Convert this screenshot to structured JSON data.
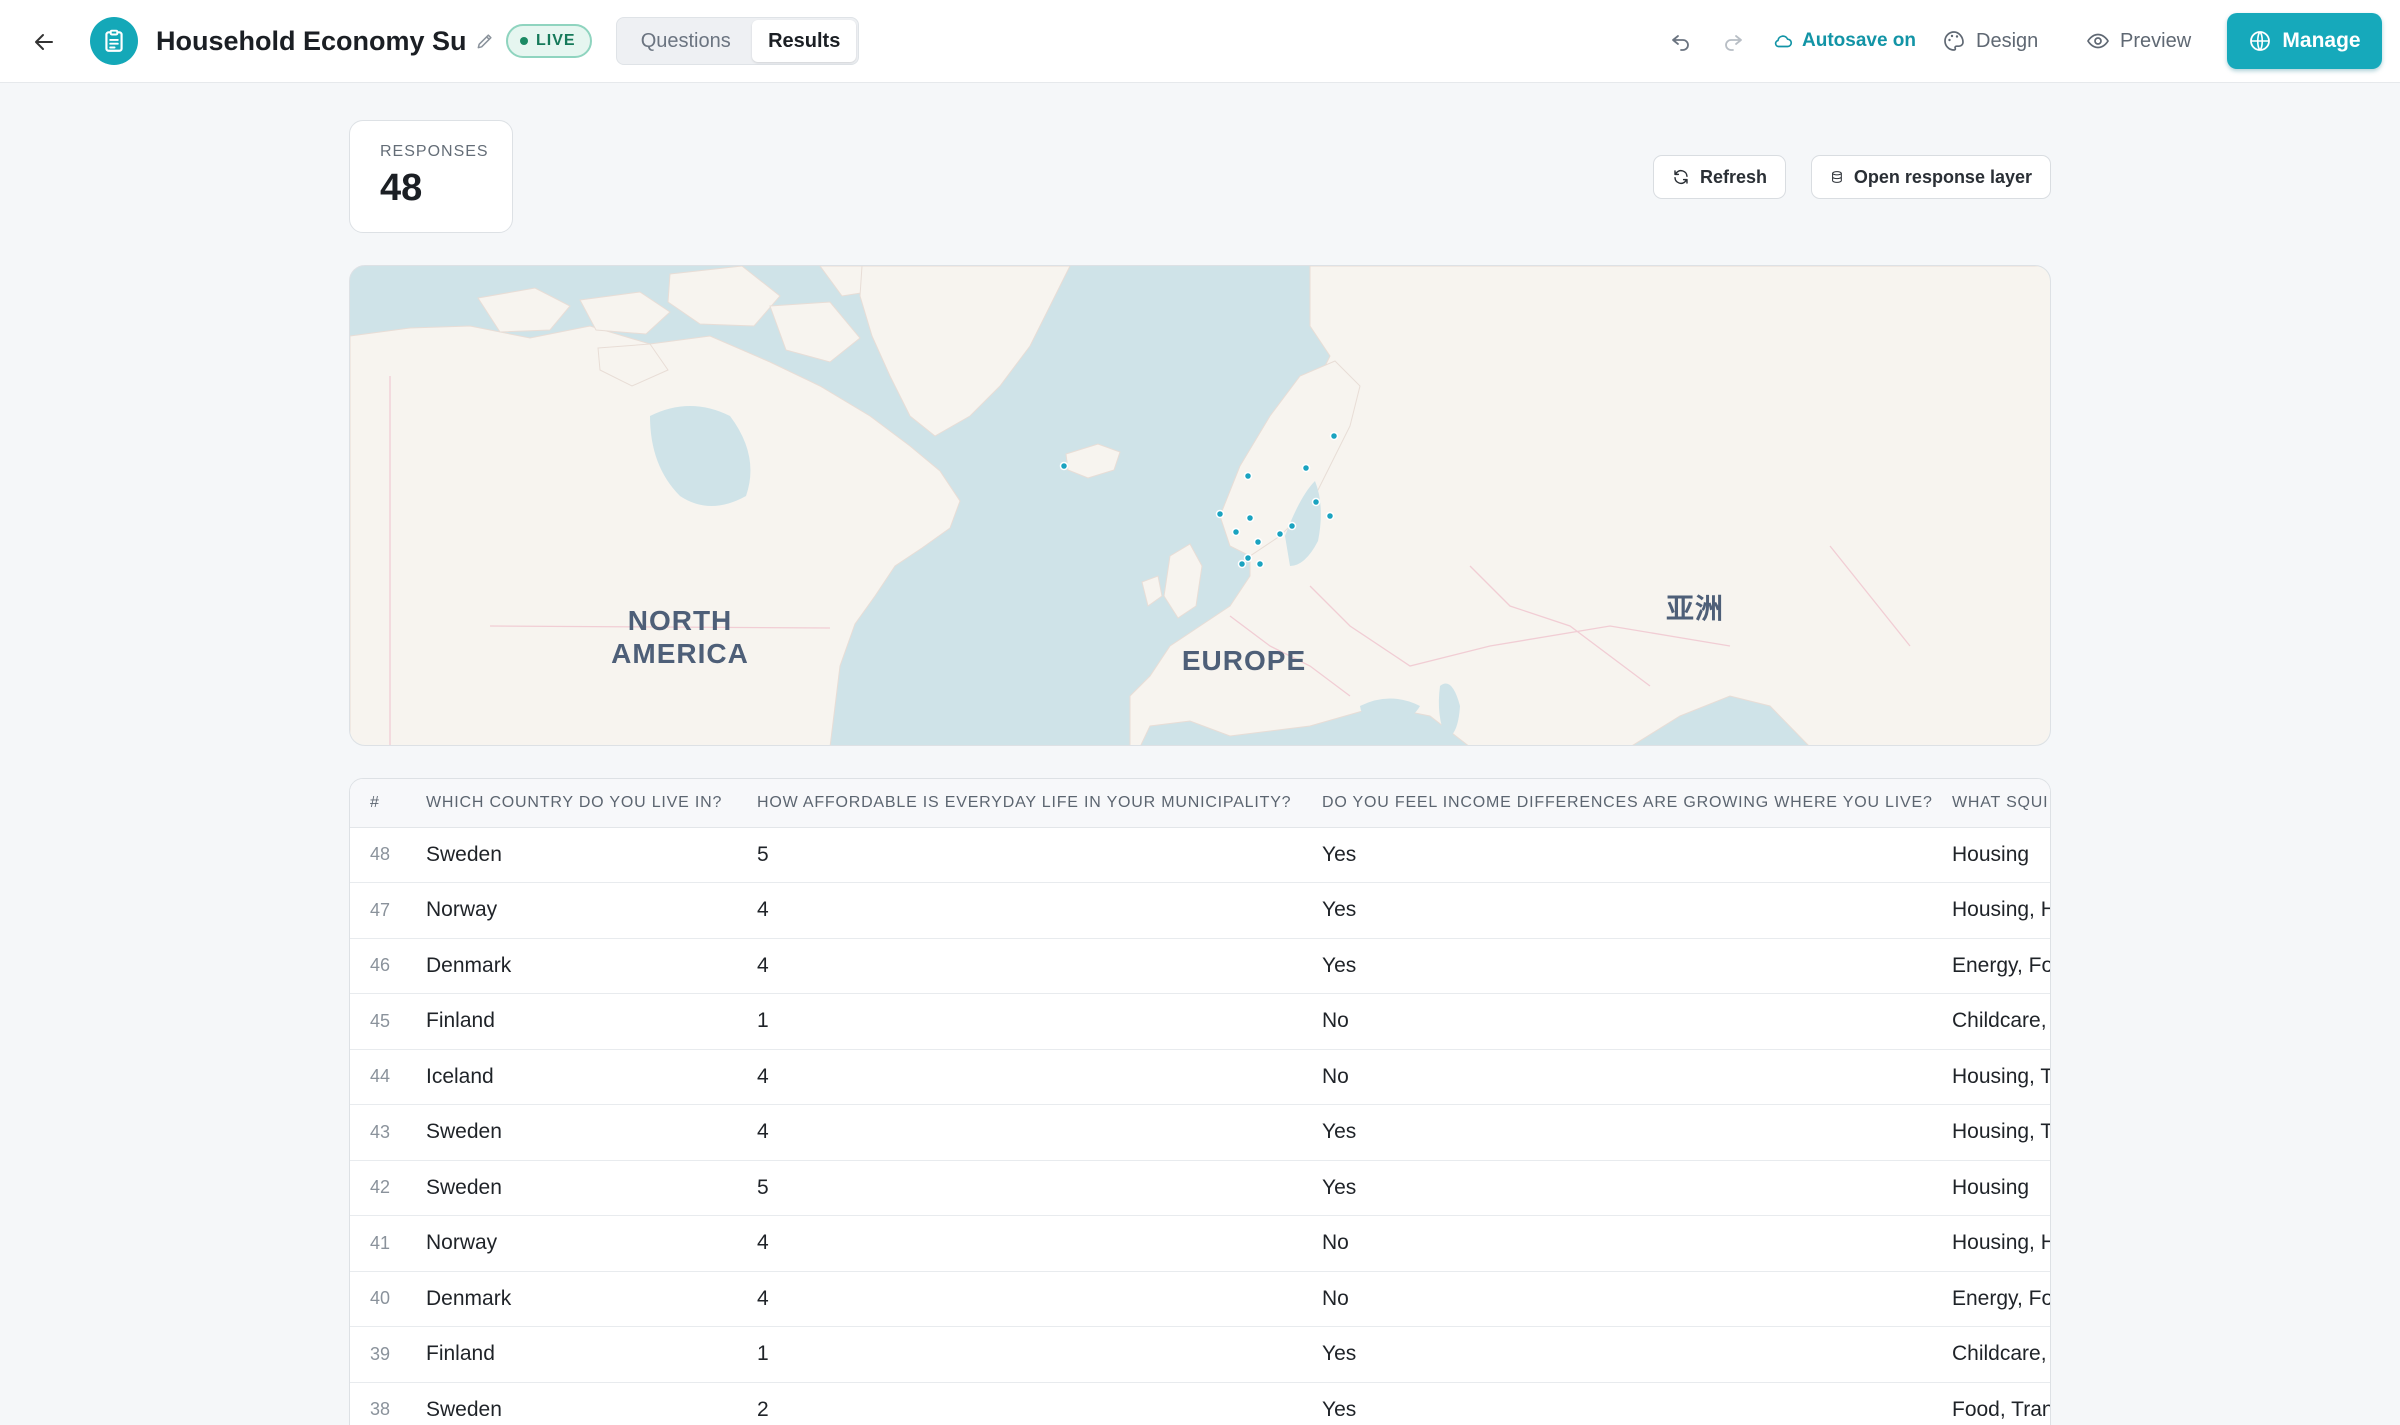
{
  "header": {
    "title": "Household Economy Surv",
    "status": "LIVE",
    "tabs": [
      {
        "label": "Questions",
        "active": false
      },
      {
        "label": "Results",
        "active": true
      }
    ],
    "autosave": "Autosave on",
    "design": "Design",
    "preview": "Preview",
    "manage": "Manage"
  },
  "summary": {
    "label": "RESPONSES",
    "count": "48",
    "refresh": "Refresh",
    "open_layer": "Open response layer"
  },
  "map": {
    "labels": {
      "north_america": "NORTH\nAMERICA",
      "europe": "EUROPE",
      "asia": "亚洲"
    },
    "point_count": 15
  },
  "table": {
    "columns": [
      "#",
      "WHICH COUNTRY DO YOU LIVE IN?",
      "HOW AFFORDABLE IS EVERYDAY LIFE IN YOUR MUNICIPALITY?",
      "DO YOU FEEL INCOME DIFFERENCES ARE GROWING WHERE YOU LIVE?",
      "WHAT SQUI"
    ],
    "rows": [
      {
        "id": "48",
        "country": "Sweden",
        "affordability": "5",
        "income_gap": "Yes",
        "squeeze": "Housing"
      },
      {
        "id": "47",
        "country": "Norway",
        "affordability": "4",
        "income_gap": "Yes",
        "squeeze": "Housing, H"
      },
      {
        "id": "46",
        "country": "Denmark",
        "affordability": "4",
        "income_gap": "Yes",
        "squeeze": "Energy, Fo"
      },
      {
        "id": "45",
        "country": "Finland",
        "affordability": "1",
        "income_gap": "No",
        "squeeze": "Childcare,"
      },
      {
        "id": "44",
        "country": "Iceland",
        "affordability": "4",
        "income_gap": "No",
        "squeeze": "Housing, T"
      },
      {
        "id": "43",
        "country": "Sweden",
        "affordability": "4",
        "income_gap": "Yes",
        "squeeze": "Housing, T"
      },
      {
        "id": "42",
        "country": "Sweden",
        "affordability": "5",
        "income_gap": "Yes",
        "squeeze": "Housing"
      },
      {
        "id": "41",
        "country": "Norway",
        "affordability": "4",
        "income_gap": "No",
        "squeeze": "Housing, H"
      },
      {
        "id": "40",
        "country": "Denmark",
        "affordability": "4",
        "income_gap": "No",
        "squeeze": "Energy, Fo"
      },
      {
        "id": "39",
        "country": "Finland",
        "affordability": "1",
        "income_gap": "Yes",
        "squeeze": "Childcare,"
      },
      {
        "id": "38",
        "country": "Sweden",
        "affordability": "2",
        "income_gap": "Yes",
        "squeeze": "Food, Tran"
      }
    ]
  },
  "colors": {
    "accent": "#16a9bb",
    "live_text": "#167a5a",
    "water": "#cfe3e8",
    "land": "#f7f4ef",
    "point": "#1aa3c0"
  }
}
